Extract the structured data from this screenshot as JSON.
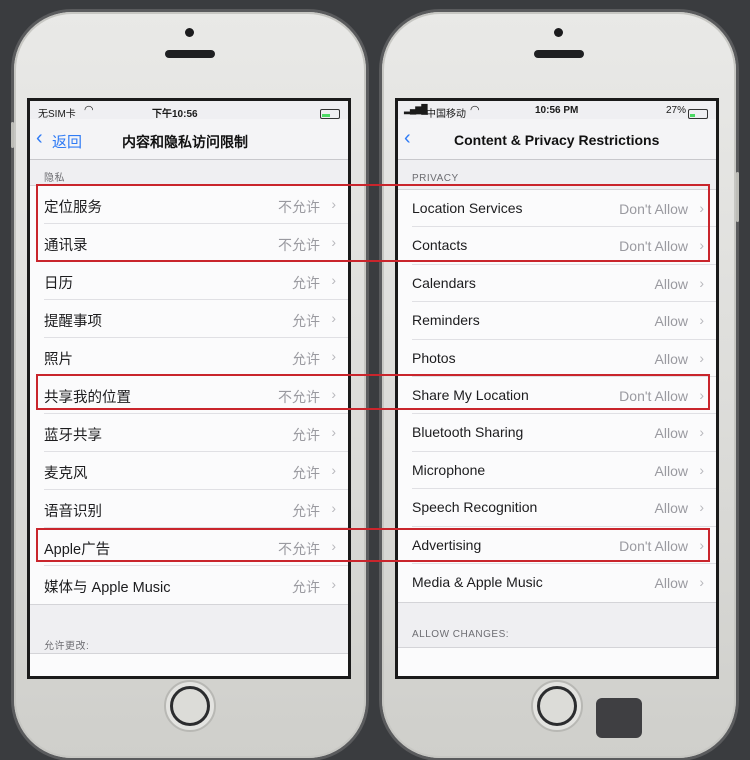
{
  "left_phone": {
    "status": {
      "carrier": "无SIM卡",
      "time": "下午10:56"
    },
    "nav": {
      "back": "返回",
      "title": "内容和隐私访问限制"
    },
    "section_privacy": "隐私",
    "rows": [
      {
        "label": "定位服务",
        "value": "不允许"
      },
      {
        "label": "通讯录",
        "value": "不允许"
      },
      {
        "label": "日历",
        "value": "允许"
      },
      {
        "label": "提醒事项",
        "value": "允许"
      },
      {
        "label": "照片",
        "value": "允许"
      },
      {
        "label": "共享我的位置",
        "value": "不允许"
      },
      {
        "label": "蓝牙共享",
        "value": "允许"
      },
      {
        "label": "麦克风",
        "value": "允许"
      },
      {
        "label": "语音识别",
        "value": "允许"
      },
      {
        "label": "Apple广告",
        "value": "不允许"
      },
      {
        "label": "媒体与 Apple Music",
        "value": "允许"
      }
    ],
    "section_changes": "允许更改:"
  },
  "right_phone": {
    "status": {
      "carrier": "中国移动",
      "time": "10:56 PM",
      "battery": "27%"
    },
    "nav": {
      "title": "Content & Privacy Restrictions"
    },
    "section_privacy": "PRIVACY",
    "rows": [
      {
        "label": "Location Services",
        "value": "Don't Allow"
      },
      {
        "label": "Contacts",
        "value": "Don't Allow"
      },
      {
        "label": "Calendars",
        "value": "Allow"
      },
      {
        "label": "Reminders",
        "value": "Allow"
      },
      {
        "label": "Photos",
        "value": "Allow"
      },
      {
        "label": "Share My Location",
        "value": "Don't Allow"
      },
      {
        "label": "Bluetooth Sharing",
        "value": "Allow"
      },
      {
        "label": "Microphone",
        "value": "Allow"
      },
      {
        "label": "Speech Recognition",
        "value": "Allow"
      },
      {
        "label": "Advertising",
        "value": "Don't Allow"
      },
      {
        "label": "Media & Apple Music",
        "value": "Allow"
      }
    ],
    "section_changes": "ALLOW CHANGES:"
  },
  "colors": {
    "highlight": "#c9252c",
    "accent": "#2f7bf5"
  },
  "icons": [
    "chevron-left-icon",
    "chevron-right-icon",
    "wifi-icon",
    "battery-icon",
    "signal-icon",
    "home-button-icon"
  ]
}
